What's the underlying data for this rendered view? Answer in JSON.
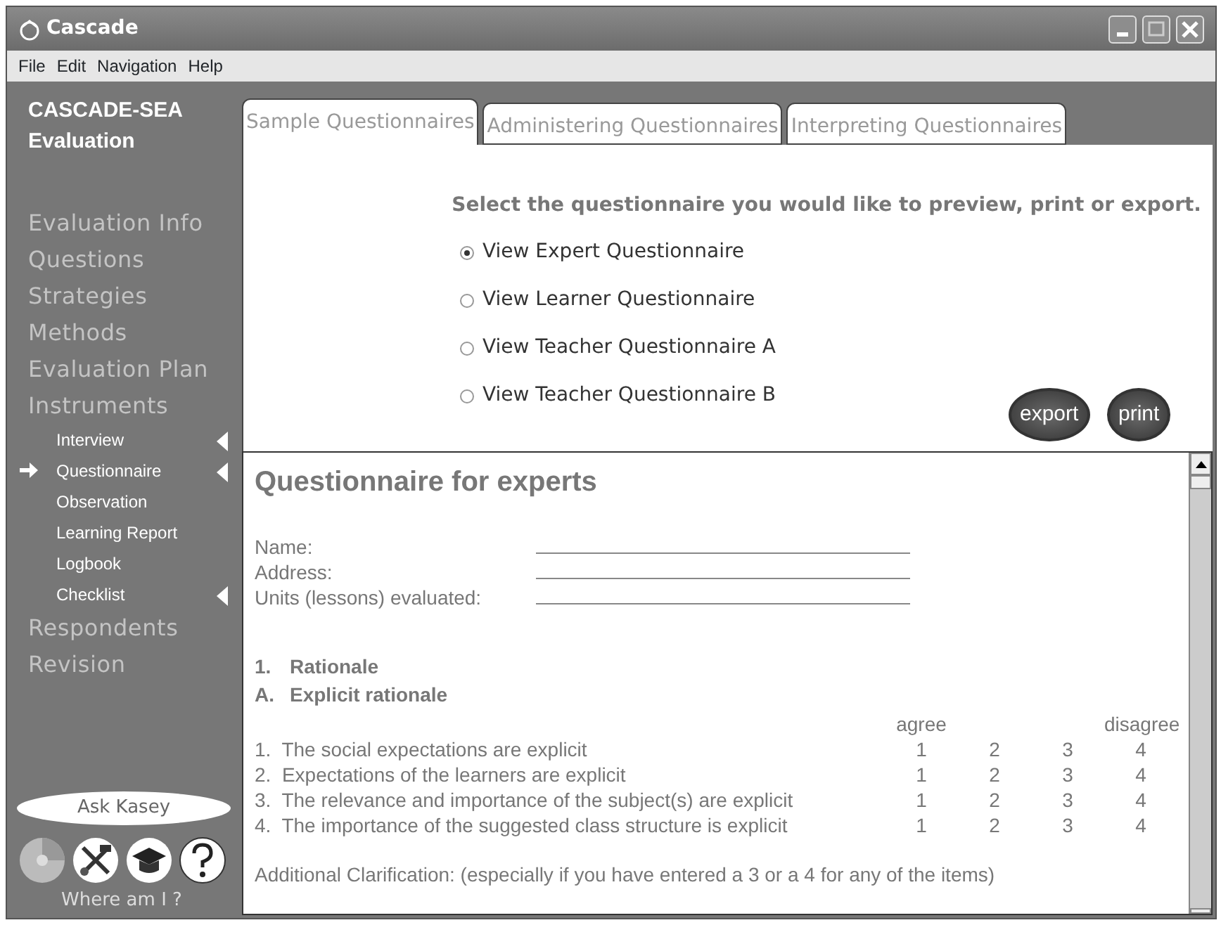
{
  "window": {
    "title": "Cascade"
  },
  "menu": [
    "File",
    "Edit",
    "Navigation",
    "Help"
  ],
  "sidebar": {
    "title": "CASCADE-SEA",
    "subtitle": "Evaluation",
    "nav": [
      {
        "label": "Evaluation Info",
        "kind": "section",
        "current": false,
        "has_submenu": false
      },
      {
        "label": "Questions",
        "kind": "section",
        "current": false,
        "has_submenu": false
      },
      {
        "label": "Strategies",
        "kind": "section",
        "current": false,
        "has_submenu": false
      },
      {
        "label": "Methods",
        "kind": "section",
        "current": false,
        "has_submenu": false
      },
      {
        "label": "Evaluation Plan",
        "kind": "section",
        "current": false,
        "has_submenu": false
      },
      {
        "label": "Instruments",
        "kind": "section",
        "current": false,
        "has_submenu": false
      },
      {
        "label": "Interview",
        "kind": "sub",
        "current": false,
        "has_submenu": true
      },
      {
        "label": "Questionnaire",
        "kind": "sub",
        "current": true,
        "has_submenu": true
      },
      {
        "label": "Observation",
        "kind": "sub",
        "current": false,
        "has_submenu": false
      },
      {
        "label": "Learning Report",
        "kind": "sub",
        "current": false,
        "has_submenu": false
      },
      {
        "label": "Logbook",
        "kind": "sub",
        "current": false,
        "has_submenu": false
      },
      {
        "label": "Checklist",
        "kind": "sub",
        "current": false,
        "has_submenu": true
      },
      {
        "label": "Respondents",
        "kind": "section",
        "current": false,
        "has_submenu": false
      },
      {
        "label": "Revision",
        "kind": "section",
        "current": false,
        "has_submenu": false
      }
    ],
    "ask_button": "Ask Kasey",
    "where_label": "Where am I ?"
  },
  "tabs": [
    {
      "label": "Sample Questionnaires",
      "selected": true
    },
    {
      "label": "Administering Questionnaires",
      "selected": false
    },
    {
      "label": "Interpreting Questionnaires",
      "selected": false
    }
  ],
  "prompt": "Select the questionnaire you would like to preview, print or export.",
  "options": [
    {
      "label": "View Expert Questionnaire",
      "selected": true
    },
    {
      "label": "View Learner Questionnaire",
      "selected": false
    },
    {
      "label": "View Teacher Questionnaire A",
      "selected": false
    },
    {
      "label": "View Teacher Questionnaire B",
      "selected": false
    }
  ],
  "buttons": [
    "export",
    "print"
  ],
  "document": {
    "title": "Questionnaire for experts",
    "fields": [
      {
        "label": "Name:"
      },
      {
        "label": "Address:"
      },
      {
        "label": "Units (lessons) evaluated:"
      }
    ],
    "sections": [
      {
        "number": "1.",
        "title": "Rationale"
      },
      {
        "number": "A.",
        "title": "Explicit rationale"
      }
    ],
    "scale_low": "agree",
    "scale_high": "disagree",
    "items": [
      {
        "text": "1.  The social expectations are explicit",
        "scale": [
          "1",
          "2",
          "3",
          "4"
        ]
      },
      {
        "text": "2.  Expectations of the learners are explicit",
        "scale": [
          "1",
          "2",
          "3",
          "4"
        ]
      },
      {
        "text": "3.  The relevance and importance of the subject(s) are explicit",
        "scale": [
          "1",
          "2",
          "3",
          "4"
        ]
      },
      {
        "text": "4.  The importance of the suggested class structure is explicit",
        "scale": [
          "1",
          "2",
          "3",
          "4"
        ]
      }
    ],
    "note": "Additional Clarification: (especially if you have entered a 3 or a 4 for any of the items)"
  }
}
